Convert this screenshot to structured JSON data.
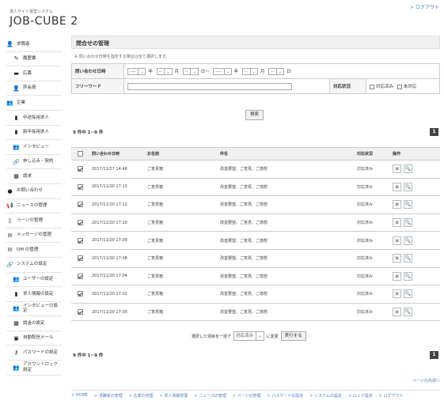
{
  "header": {
    "system_name": "求人サイト運営システム",
    "app_title": "JOB-CUBE 2",
    "logout": "> ログアウト"
  },
  "sidebar": {
    "items": [
      {
        "label": "求職者",
        "icon": "user-icon",
        "sub": false
      },
      {
        "label": "履歴書",
        "icon": "pen-icon",
        "sub": true
      },
      {
        "label": "応募",
        "icon": "briefcase-icon",
        "sub": true
      },
      {
        "label": "評会員",
        "icon": "user-icon",
        "sub": true
      },
      {
        "label": "企業",
        "icon": "users-icon",
        "sub": false
      },
      {
        "label": "中途採用求人",
        "icon": "document-icon",
        "sub": true
      },
      {
        "label": "新卒採用求人",
        "icon": "document-icon",
        "sub": true
      },
      {
        "label": "インタビュー",
        "icon": "users-icon",
        "sub": true
      },
      {
        "label": "申し込み・契約",
        "icon": "link-icon",
        "sub": true
      },
      {
        "label": "請求",
        "icon": "calculator-icon",
        "sub": true
      },
      {
        "label": "お問い合わせ",
        "icon": "info-icon",
        "sub": false
      },
      {
        "label": "ニュースの管理",
        "icon": "megaphone-icon",
        "sub": false
      },
      {
        "label": "ページの管理",
        "icon": "page-icon",
        "sub": false
      },
      {
        "label": "メッセージの管理",
        "icon": "mail-icon",
        "sub": false
      },
      {
        "label": "DM の管理",
        "icon": "mail-icon",
        "sub": false
      },
      {
        "label": "システムの設定",
        "icon": "link-icon",
        "sub": false
      },
      {
        "label": "ユーザーの設定",
        "icon": "users-icon",
        "sub": true
      },
      {
        "label": "求人情報の設定",
        "icon": "document-icon",
        "sub": true
      },
      {
        "label": "インタビューの設定",
        "icon": "users-icon",
        "sub": true
      },
      {
        "label": "請金の設定",
        "icon": "calculator-icon",
        "sub": true
      },
      {
        "label": "自動配信メール",
        "icon": "monitor-icon",
        "sub": true
      },
      {
        "label": "パスワードの設定",
        "icon": "key-icon",
        "sub": true
      },
      {
        "label": "アカウントロック設定",
        "icon": "users-icon",
        "sub": true
      }
    ]
  },
  "page": {
    "title": "問合せの管理",
    "note": "※ 問い合わせ日時を指定する場合は全て選択します。"
  },
  "filter": {
    "date_label": "問い合わせ日時",
    "dash": "----",
    "short_dash": "--",
    "year": "年",
    "month": "月",
    "day_range": "日〜",
    "day": "日",
    "freeword_label": "フリーワード",
    "status_label": "対応状況",
    "status_opt1": "対応済み",
    "status_opt2": "未対応",
    "search_button": "検索"
  },
  "result_count": "9 件中 1~9 件",
  "pagination": {
    "current": "1"
  },
  "list": {
    "columns": [
      "問い合わせ日時",
      "お名前",
      "件名",
      "対応状況",
      "操作"
    ],
    "rows": [
      {
        "date": "2017/11/27 14:46",
        "name": "ご意見箱",
        "subject": "改善要望、ご意見、ご感想",
        "status": "対応済み"
      },
      {
        "date": "2017/11/20 17:13",
        "name": "ご意見箱",
        "subject": "改善要望、ご意見、ご感想",
        "status": "対応済み"
      },
      {
        "date": "2017/11/20 17:12",
        "name": "ご意見箱",
        "subject": "改善要望、ご意見、ご感想",
        "status": "対応済み"
      },
      {
        "date": "2017/11/20 17:10",
        "name": "ご意見箱",
        "subject": "改善要望、ご意見、ご感想",
        "status": "対応済み"
      },
      {
        "date": "2017/11/20 17:09",
        "name": "ご意見箱",
        "subject": "改善要望、ご意見、ご感想",
        "status": "対応済み"
      },
      {
        "date": "2017/11/20 17:08",
        "name": "ご意見箱",
        "subject": "改善要望、ご意見、ご感想",
        "status": "対応済み"
      },
      {
        "date": "2017/11/20 17:04",
        "name": "ご意見箱",
        "subject": "改善要望、ご意見、ご感想",
        "status": "対応済み"
      },
      {
        "date": "2017/11/20 17:02",
        "name": "ご意見箱",
        "subject": "改善要望、ご意見、ご感想",
        "status": "対応済み"
      },
      {
        "date": "2017/11/20 17:00",
        "name": "ご意見箱",
        "subject": "改善要望、ご意見、ご感想",
        "status": "対応済み"
      }
    ],
    "delete_glyph": "✕",
    "view_glyph": "🔍"
  },
  "bulk": {
    "prefix": "選択した項目を一括で",
    "selected": "対応済み",
    "suffix": "に変更",
    "button": "実行する"
  },
  "pagetop": "ページの先頭へ",
  "footer": {
    "links": [
      "> HOME",
      "> 求職者の管理",
      "> 企業の管理",
      "> 求人情報管理",
      "> ニュースの管理",
      "> ページの管理",
      "> パスワードの設定",
      "> システムの設定",
      "> ロック設定",
      "> ログアウト"
    ]
  }
}
